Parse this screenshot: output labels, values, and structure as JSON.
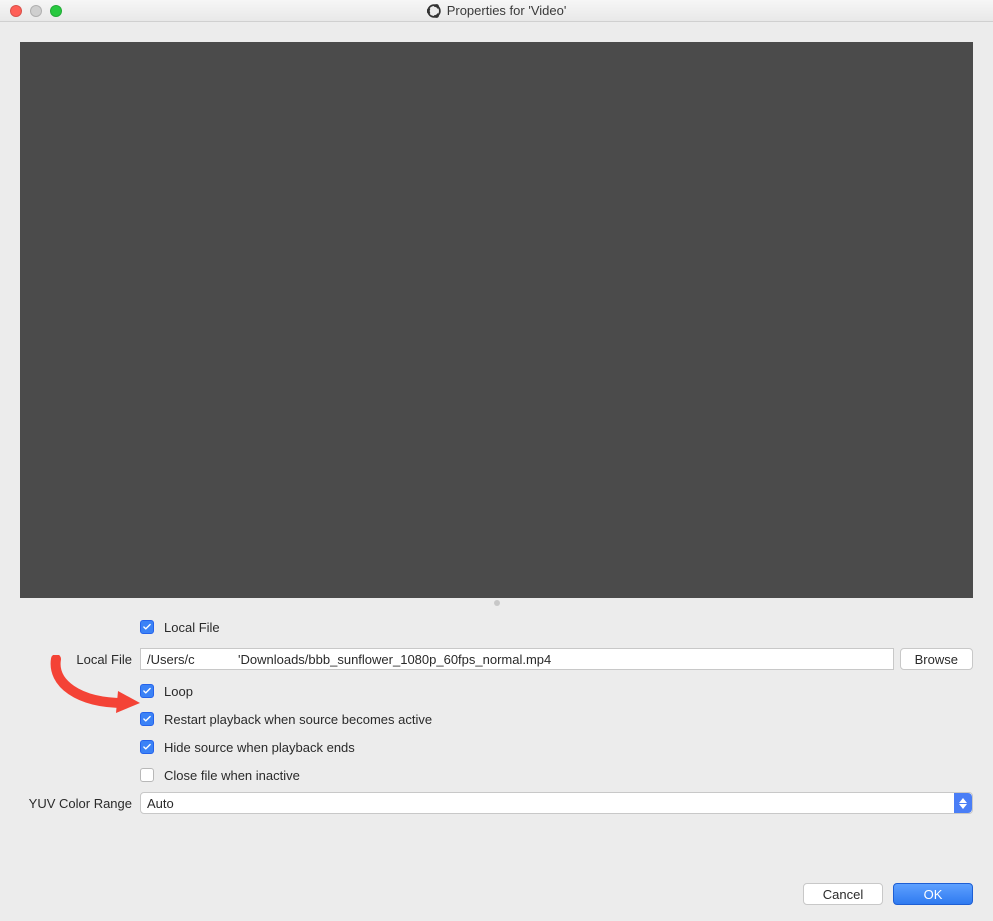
{
  "window": {
    "title": "Properties for 'Video'"
  },
  "form": {
    "local_file_checkbox_label": "Local File",
    "local_file_label": "Local File",
    "local_file_value": "/Users/c            'Downloads/bbb_sunflower_1080p_60fps_normal.mp4",
    "browse_label": "Browse",
    "loop_label": "Loop",
    "restart_label": "Restart playback when source becomes active",
    "hide_label": "Hide source when playback ends",
    "close_label": "Close file when inactive",
    "yuv_label": "YUV Color Range",
    "yuv_value": "Auto"
  },
  "footer": {
    "cancel": "Cancel",
    "ok": "OK"
  }
}
